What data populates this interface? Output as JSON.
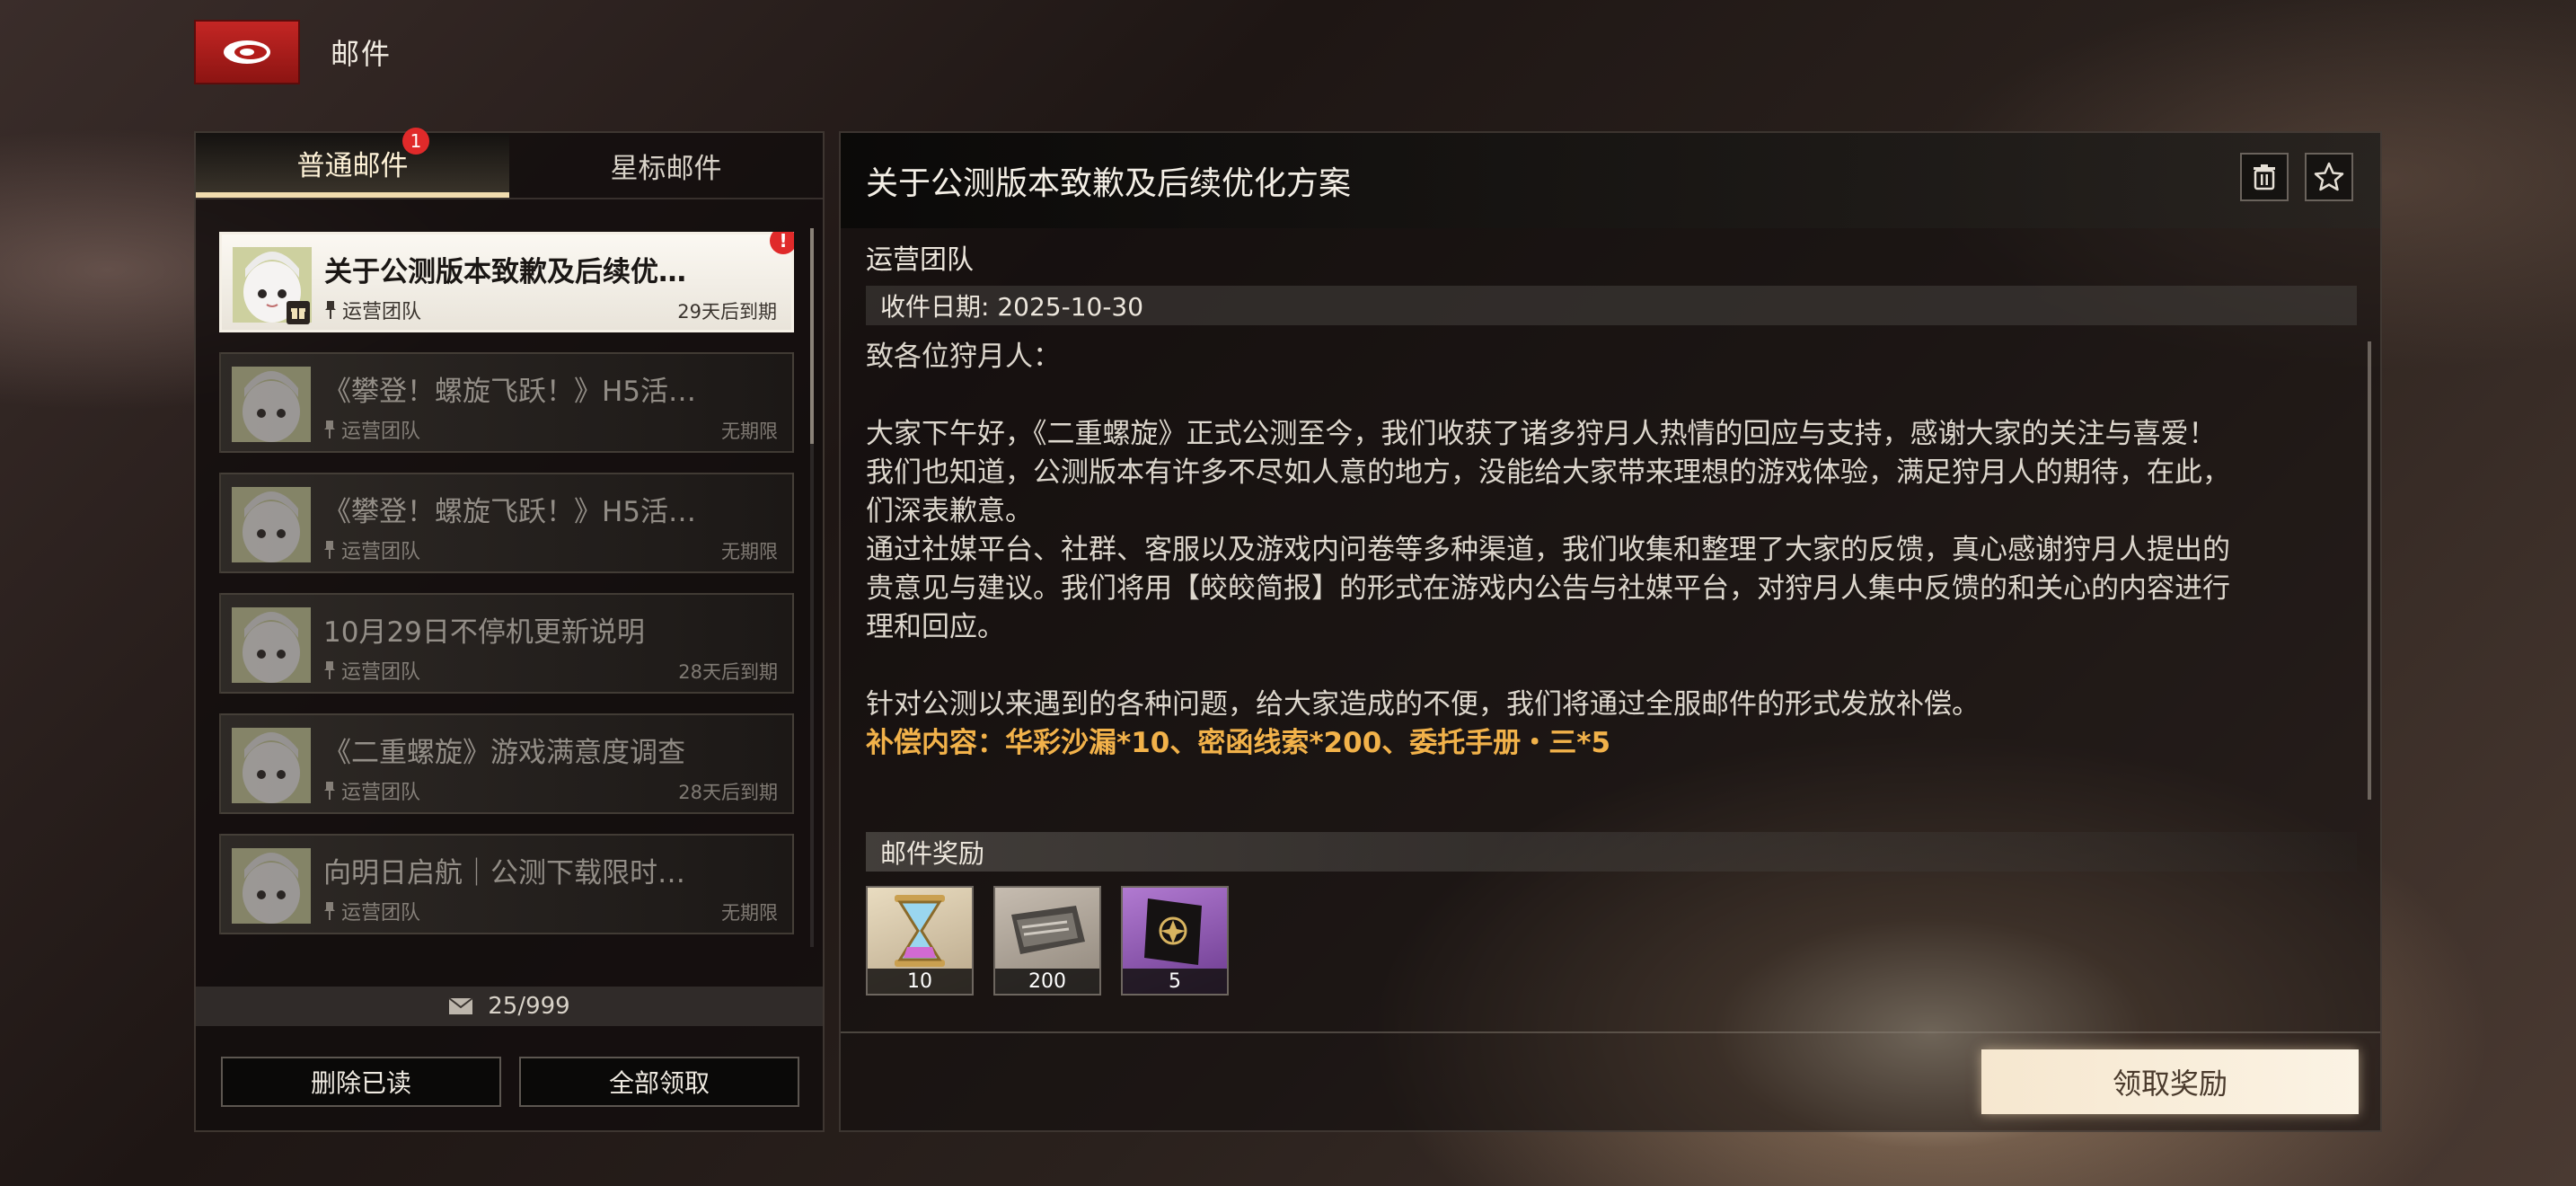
{
  "header": {
    "title": "邮件",
    "back_icon": "back-emblem-icon"
  },
  "tabs": [
    {
      "label": "普通邮件",
      "active": true,
      "badge": "1"
    },
    {
      "label": "星标邮件",
      "active": false
    }
  ],
  "mails": [
    {
      "title": "关于公测版本致歉及后续优…",
      "sender": "运营团队",
      "expiry": "29天后到期",
      "alert": "!"
    },
    {
      "title": "《攀登！螺旋飞跃！》H5活…",
      "sender": "运营团队",
      "expiry": "无期限"
    },
    {
      "title": "《攀登！螺旋飞跃！》H5活…",
      "sender": "运营团队",
      "expiry": "无期限"
    },
    {
      "title": "10月29日不停机更新说明",
      "sender": "运营团队",
      "expiry": "28天后到期"
    },
    {
      "title": "《二重螺旋》游戏满意度调查",
      "sender": "运营团队",
      "expiry": "28天后到期"
    },
    {
      "title": "向明日启航｜公测下载限时…",
      "sender": "运营团队",
      "expiry": "无期限"
    }
  ],
  "mail_count": "25/999",
  "actions": {
    "delete_read": "删除已读",
    "claim_all": "全部领取"
  },
  "detail": {
    "title": "关于公测版本致歉及后续优化方案",
    "sender": "运营团队",
    "date": "收件日期: 2025-10-30",
    "body": "致各位狩月人：\n\n大家下午好，《二重螺旋》正式公测至今，我们收获了诸多狩月人热情的回应与支持，感谢大家的关注与喜爱！\n我们也知道，公测版本有许多不尽如人意的地方，没能给大家带来理想的游戏体验，满足狩月人的期待，在此，\n们深表歉意。\n通过社媒平台、社群、客服以及游戏内问卷等多种渠道，我们收集和整理了大家的反馈，真心感谢狩月人提出的\n贵意见与建议。我们将用【皎皎简报】的形式在游戏内公告与社媒平台，对狩月人集中反馈的和关心的内容进行\n理和回应。\n\n针对公测以来遇到的各种问题，给大家造成的不便，我们将通过全服邮件的形式发放补偿。",
    "compensation": "补偿内容：华彩沙漏*10、密函线索*200、委托手册・三*5",
    "rewards_label": "邮件奖励",
    "rewards": [
      {
        "icon": "hourglass-icon",
        "qty": "10"
      },
      {
        "icon": "clue-letter-icon",
        "qty": "200"
      },
      {
        "icon": "commission-manual-icon",
        "qty": "5"
      }
    ],
    "claim_label": "领取奖励"
  },
  "colors": {
    "accent": "#f1dcae",
    "alert": "#e02a2a",
    "compensation": "#f2b24a",
    "brand_red": "#c42624"
  }
}
